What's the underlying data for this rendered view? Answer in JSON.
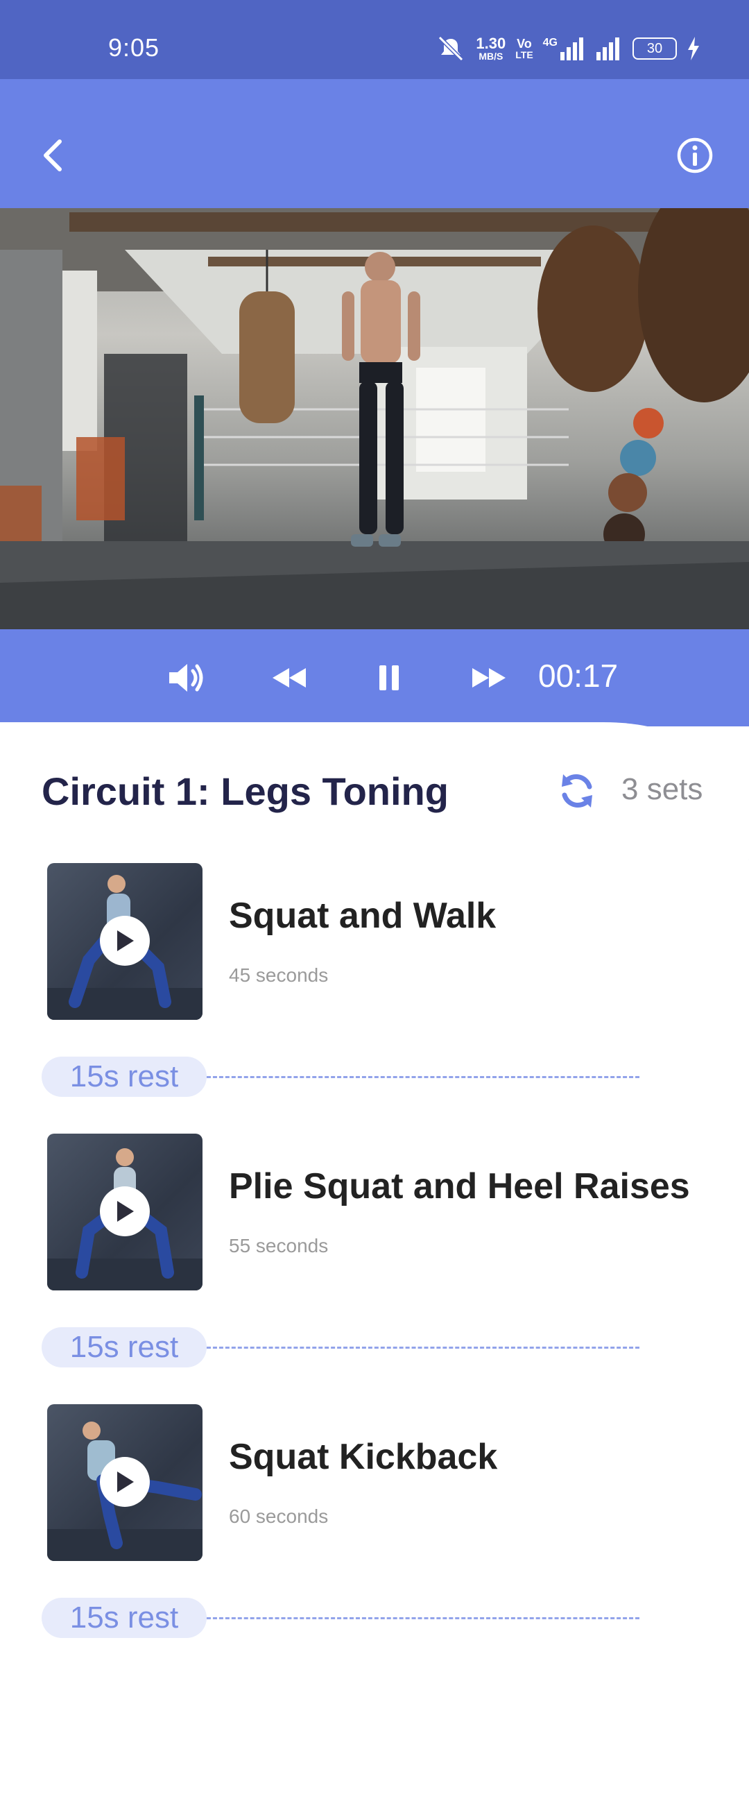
{
  "status_bar": {
    "time": "9:05",
    "net_speed_value": "1.30",
    "net_speed_unit": "MB/S",
    "volte_label_top": "Vo",
    "volte_label_bottom": "LTE",
    "network_type": "4G",
    "battery": "30"
  },
  "app_bar": {
    "back_icon": "chevron-left-icon",
    "info_icon": "info-icon"
  },
  "player": {
    "timer": "00:17",
    "volume_icon": "volume-icon",
    "rewind_icon": "rewind-icon",
    "pause_icon": "pause-icon",
    "forward_icon": "fast-forward-icon"
  },
  "circuit": {
    "title": "Circuit 1: Legs Toning",
    "sets": "3 sets",
    "sets_icon": "repeat-icon"
  },
  "exercises": [
    {
      "name": "Squat and Walk",
      "duration": "45 seconds"
    },
    {
      "name": "Plie Squat and Heel Raises",
      "duration": "55 seconds"
    },
    {
      "name": "Squat Kickback",
      "duration": "60 seconds"
    }
  ],
  "rests": [
    "15s rest",
    "15s rest",
    "15s rest"
  ],
  "colors": {
    "status_bar": "#5065c3",
    "accent": "#6a82e6",
    "title_text": "#23244a",
    "rest_pill_bg": "#e7ebfb",
    "rest_pill_text": "#7a8fe3"
  }
}
